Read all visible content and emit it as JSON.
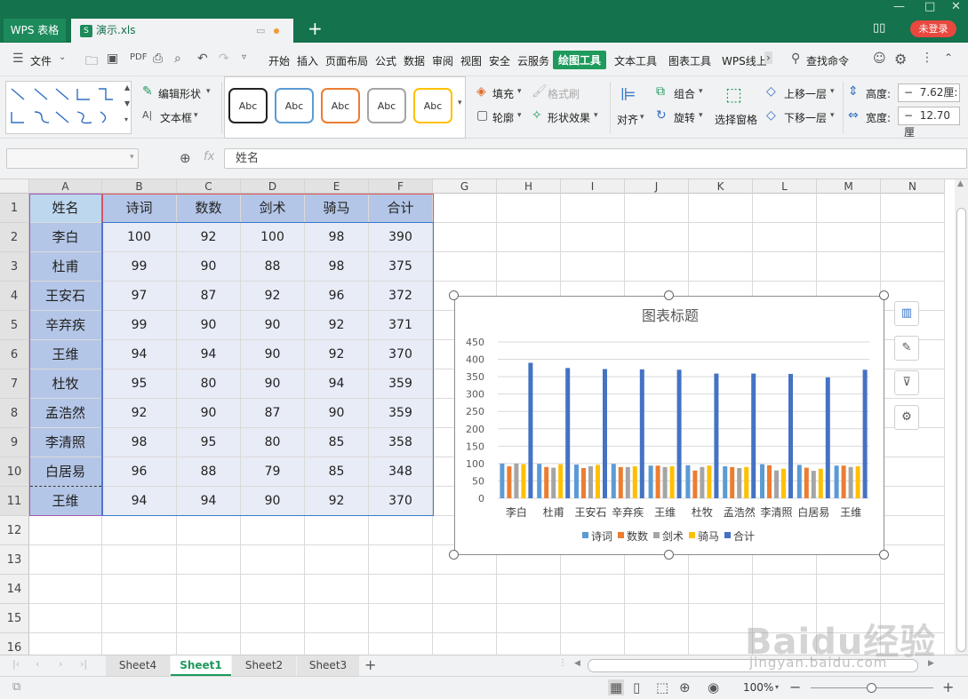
{
  "app": {
    "app_tab": "WPS 表格",
    "doc_tab": "演示.xls",
    "login": "未登录"
  },
  "menu": {
    "file": "文件",
    "items": [
      "开始",
      "插入",
      "页面布局",
      "公式",
      "数据",
      "审阅",
      "视图",
      "安全",
      "云服务",
      "绘图工具",
      "文本工具",
      "图表工具",
      "WPS线上"
    ],
    "active": "绘图工具",
    "search": "查找命令"
  },
  "ribbon": {
    "edit_shape": "编辑形状",
    "textbox": "文本框",
    "style_samples": [
      "Abc",
      "Abc",
      "Abc",
      "Abc",
      "Abc"
    ],
    "style_colors": [
      "#222222",
      "#5b9bd5",
      "#ed7d31",
      "#a5a5a5",
      "#ffc000"
    ],
    "fill": "填充",
    "format_brush": "格式刷",
    "outline": "轮廓",
    "shape_effect": "形状效果",
    "align": "对齐",
    "group": "组合",
    "rotate": "旋转",
    "select_pane": "选择窗格",
    "bring_forward": "上移一层",
    "send_backward": "下移一层",
    "height_label": "高度:",
    "height_value": "7.62厘:",
    "width_label": "宽度:",
    "width_value": "12.70厘"
  },
  "formula_bar": {
    "fx": "fx",
    "content": "姓名"
  },
  "sheet": {
    "columns": [
      "A",
      "B",
      "C",
      "D",
      "E",
      "F",
      "G",
      "H",
      "I",
      "J",
      "K",
      "L",
      "M",
      "N"
    ],
    "rows": [
      "1",
      "2",
      "3",
      "4",
      "5",
      "6",
      "7",
      "8",
      "9",
      "10",
      "11",
      "12",
      "13",
      "14",
      "15",
      "16"
    ],
    "header": [
      "姓名",
      "诗词",
      "数数",
      "剑术",
      "骑马",
      "合计"
    ],
    "data": [
      [
        "李白",
        "100",
        "92",
        "100",
        "98",
        "390"
      ],
      [
        "杜甫",
        "99",
        "90",
        "88",
        "98",
        "375"
      ],
      [
        "王安石",
        "97",
        "87",
        "92",
        "96",
        "372"
      ],
      [
        "辛弃疾",
        "99",
        "90",
        "90",
        "92",
        "371"
      ],
      [
        "王维",
        "94",
        "94",
        "90",
        "92",
        "370"
      ],
      [
        "杜牧",
        "95",
        "80",
        "90",
        "94",
        "359"
      ],
      [
        "孟浩然",
        "92",
        "90",
        "87",
        "90",
        "359"
      ],
      [
        "李清照",
        "98",
        "95",
        "80",
        "85",
        "358"
      ],
      [
        "白居易",
        "96",
        "88",
        "79",
        "85",
        "348"
      ],
      [
        "王维",
        "94",
        "94",
        "90",
        "92",
        "370"
      ]
    ]
  },
  "chart_data": {
    "type": "bar",
    "title": "图表标题",
    "categories": [
      "李白",
      "杜甫",
      "王安石",
      "辛弃疾",
      "王维",
      "杜牧",
      "孟浩然",
      "李清照",
      "白居易",
      "王维"
    ],
    "series": [
      {
        "name": "诗词",
        "color": "#5b9bd5",
        "values": [
          100,
          99,
          97,
          99,
          94,
          95,
          92,
          98,
          96,
          94
        ]
      },
      {
        "name": "数数",
        "color": "#ed7d31",
        "values": [
          92,
          90,
          87,
          90,
          94,
          80,
          90,
          95,
          88,
          94
        ]
      },
      {
        "name": "剑术",
        "color": "#a5a5a5",
        "values": [
          100,
          88,
          92,
          90,
          90,
          90,
          87,
          80,
          79,
          90
        ]
      },
      {
        "name": "骑马",
        "color": "#ffc000",
        "values": [
          98,
          98,
          96,
          92,
          92,
          94,
          90,
          85,
          85,
          92
        ]
      },
      {
        "name": "合计",
        "color": "#4472c4",
        "values": [
          390,
          375,
          372,
          371,
          370,
          359,
          359,
          358,
          348,
          370
        ]
      }
    ],
    "ylim": [
      0,
      450
    ],
    "yticks": [
      "0",
      "50",
      "100",
      "150",
      "200",
      "250",
      "300",
      "350",
      "400",
      "450"
    ],
    "legend": "bottom",
    "grid": true
  },
  "sheets": {
    "tabs": [
      "Sheet4",
      "Sheet1",
      "Sheet2",
      "Sheet3"
    ],
    "active": "Sheet1"
  },
  "status": {
    "zoom": "100%"
  },
  "watermark": {
    "brand": "Baidu经验",
    "url": "jingyan.baidu.com"
  }
}
